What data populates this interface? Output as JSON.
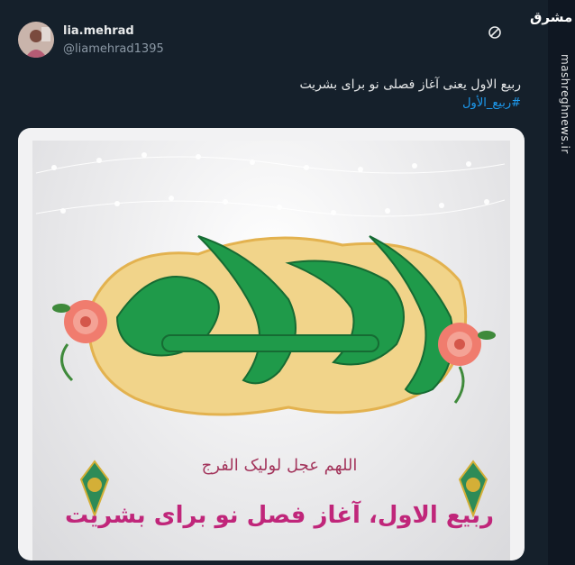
{
  "user": {
    "display_name": "lia.mehrad",
    "username": "@liamehrad1395"
  },
  "tweet": {
    "text": "ربیع الاول یعنی آغاز فصلی نو برای بشریت",
    "hashtag": "#ربیع_الأول"
  },
  "media": {
    "title_calligraphy": "ربیع الاول",
    "prayer_text": "اللهم عجل لولیک الفرج",
    "subtitle": "ربیع الاول، آغاز فصل نو برای بشریت",
    "colors": {
      "calligraphy_green": "#1f9a4a",
      "gold": "#e9c46a",
      "subtitle_magenta": "#c0267a",
      "prayer_maroon": "#a3355c"
    }
  },
  "source": {
    "brand": "مشرق",
    "watermark": "mashreghnews.ir"
  },
  "icons": {
    "more": "more-icon"
  },
  "theme": {
    "background": "#15202b",
    "text": "#e7e9ea",
    "muted": "#8b98a5",
    "link": "#1d9bf0"
  }
}
